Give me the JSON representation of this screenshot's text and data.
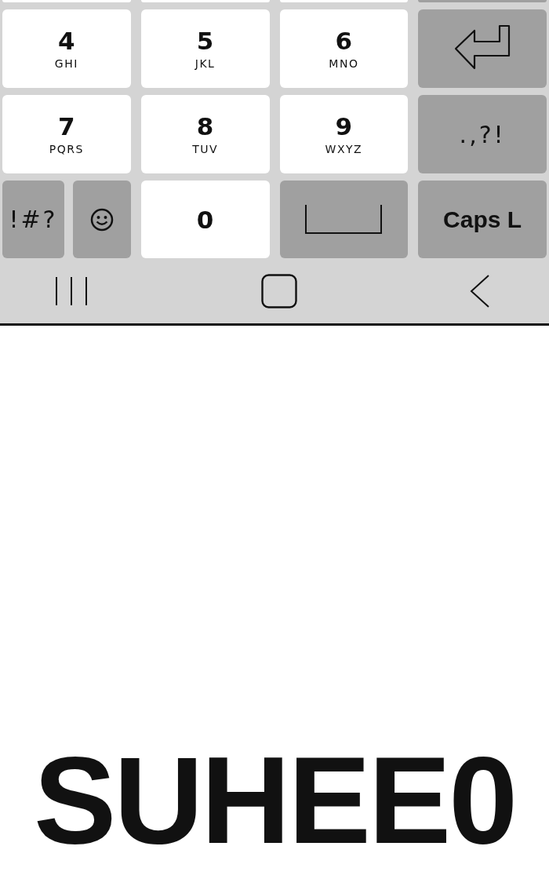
{
  "keyboard": {
    "rows": [
      [
        {
          "kind": "digit"
        },
        {
          "kind": "digit"
        },
        {
          "kind": "digit"
        },
        {
          "kind": "function"
        }
      ],
      [
        {
          "kind": "digit",
          "label": "4",
          "letters": "GHI"
        },
        {
          "kind": "digit",
          "label": "5",
          "letters": "JKL"
        },
        {
          "kind": "digit",
          "label": "6",
          "letters": "MNO"
        },
        {
          "kind": "enter"
        }
      ],
      [
        {
          "kind": "digit",
          "label": "7",
          "letters": "PQRS"
        },
        {
          "kind": "digit",
          "label": "8",
          "letters": "TUV"
        },
        {
          "kind": "digit",
          "label": "9",
          "letters": "WXYZ"
        },
        {
          "kind": "symbols",
          "label": ".,?!"
        }
      ],
      [
        {
          "kind": "pair",
          "keys": [
            {
              "kind": "symbols",
              "label": "!#?"
            },
            {
              "kind": "emoji"
            }
          ]
        },
        {
          "kind": "digit",
          "label": "0"
        },
        {
          "kind": "space"
        },
        {
          "kind": "function",
          "label": "Caps L"
        }
      ]
    ]
  },
  "nav_bar": {
    "buttons": [
      {
        "kind": "recents"
      },
      {
        "kind": "home"
      },
      {
        "kind": "back"
      }
    ]
  },
  "logo": {
    "text": "SUHEE0"
  }
}
